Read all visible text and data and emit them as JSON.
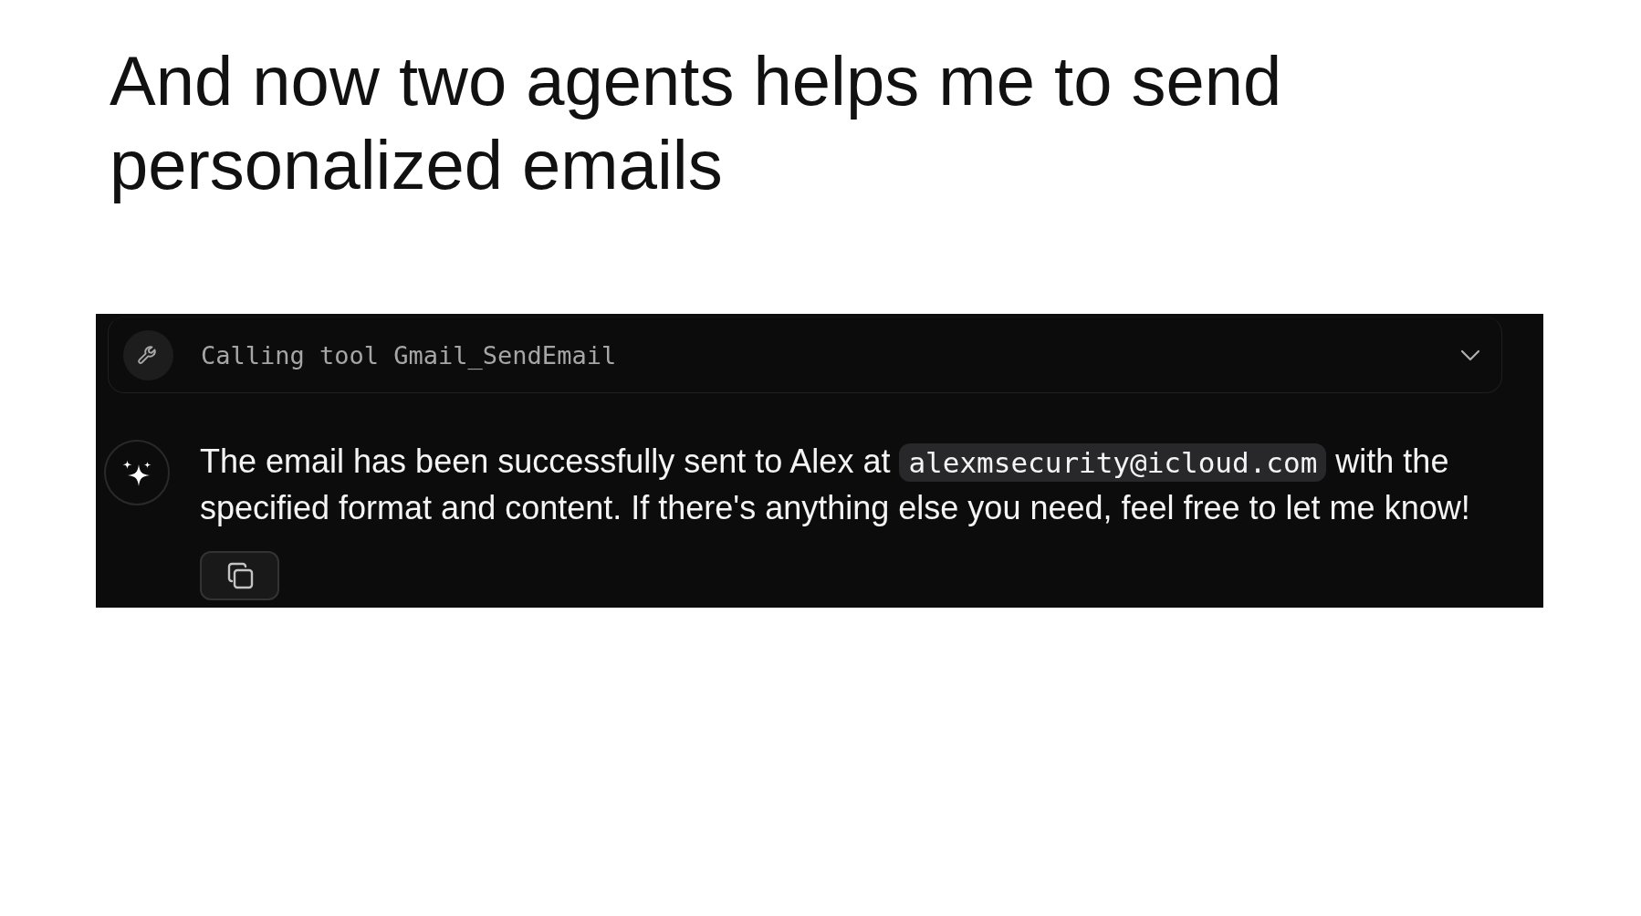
{
  "slide": {
    "title": "And now two agents helps me to send personalized emails"
  },
  "chat": {
    "tool_call": {
      "label": "Calling tool Gmail_SendEmail",
      "expanded": false
    },
    "message": {
      "parts": [
        {
          "kind": "text",
          "text": "The email has been successfully sent to Alex at "
        },
        {
          "kind": "code",
          "text": "alexmsecurity@icloud.com"
        },
        {
          "kind": "text",
          "text": " with the specified format and content. If there's anything else you need, feel free to let me know!"
        }
      ]
    }
  }
}
